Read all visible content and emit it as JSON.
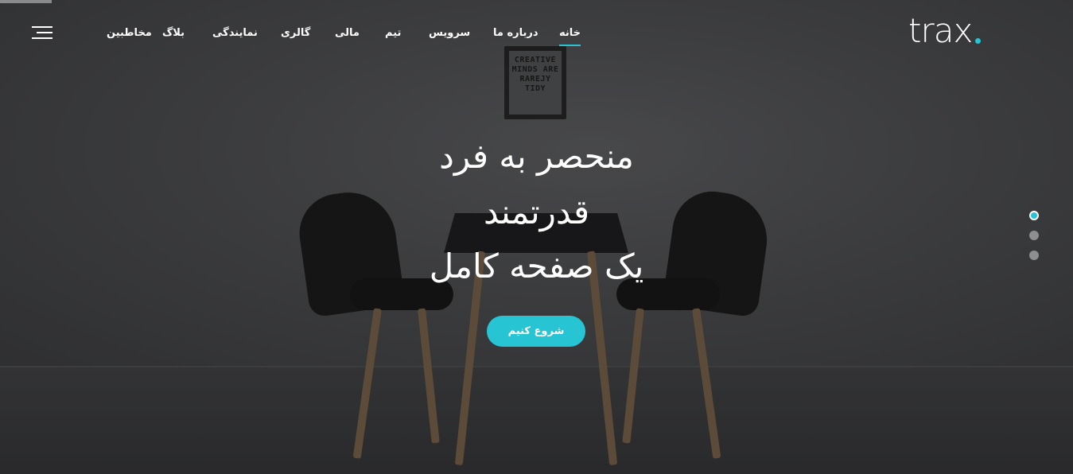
{
  "brand": {
    "logo_text": "trax",
    "accent_color": "#27c4d4"
  },
  "nav": {
    "items": [
      {
        "label": "خانه",
        "active": true
      },
      {
        "label": "درباره ما",
        "active": false
      },
      {
        "label": "سرویس",
        "active": false
      },
      {
        "label": "تیم",
        "active": false
      },
      {
        "label": "مالی",
        "active": false
      },
      {
        "label": "گالری",
        "active": false
      },
      {
        "label": "نمایندگی",
        "active": false
      },
      {
        "label": "بلاگ",
        "active": false
      },
      {
        "label": "مخاطبین",
        "active": false
      }
    ],
    "menu_icon": "hamburger-menu-icon"
  },
  "hero": {
    "lines": [
      "منحصر به فرد",
      "قدرتمند",
      "یک صفحه کامل"
    ],
    "cta_label": "شروع کنیم",
    "frame_text": "CREATIVE MINDS ARE RAREJY TIDY"
  },
  "slider": {
    "count": 3,
    "active_index": 0
  }
}
